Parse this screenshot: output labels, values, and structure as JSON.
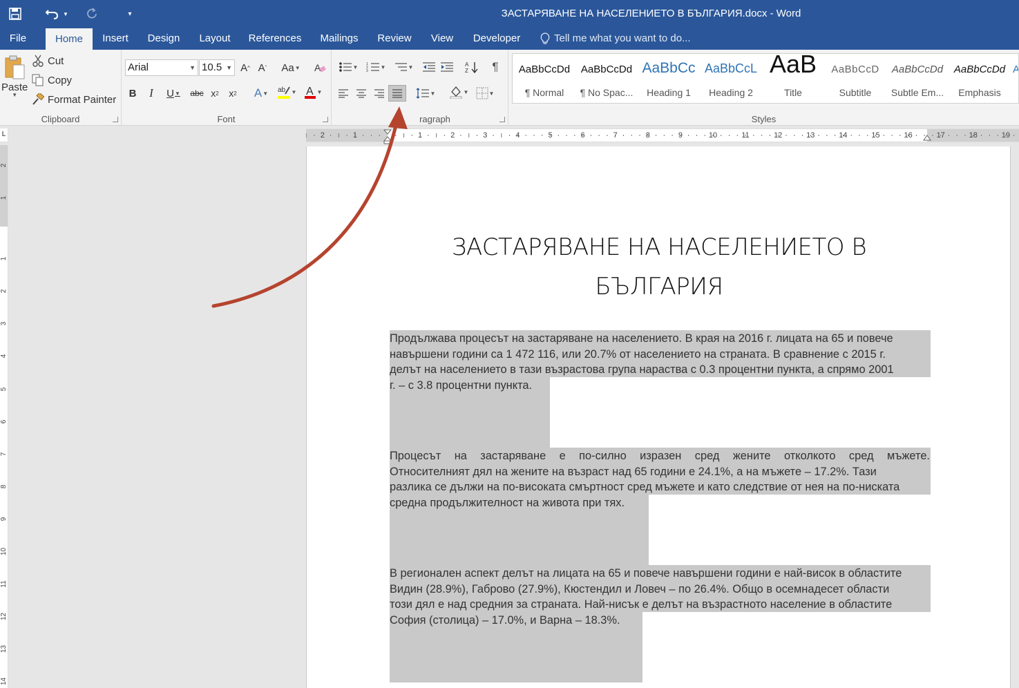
{
  "window": {
    "title": "ЗАСТАРЯВАНЕ НА НАСЕЛЕНИЕТО В БЪЛГАРИЯ.docx - Word"
  },
  "tabs": [
    "File",
    "Home",
    "Insert",
    "Design",
    "Layout",
    "References",
    "Mailings",
    "Review",
    "View",
    "Developer"
  ],
  "active_tab": "Home",
  "tell_me": "Tell me what you want to do...",
  "clipboard": {
    "paste": "Paste",
    "cut": "Cut",
    "copy": "Copy",
    "format_painter": "Format Painter",
    "label": "Clipboard"
  },
  "font": {
    "family": "Arial",
    "size": "10.5",
    "change_case": "Aa",
    "label": "Font"
  },
  "paragraph": {
    "label": "Paragraph",
    "label_visible": "ragraph",
    "active_alignment": "justify"
  },
  "styles": {
    "label": "Styles",
    "items": [
      {
        "preview": "AaBbCcDd",
        "name": "¶ Normal"
      },
      {
        "preview": "AaBbCcDd",
        "name": "¶ No Spac..."
      },
      {
        "preview": "AaBbCc",
        "name": "Heading 1"
      },
      {
        "preview": "AaBbCcL",
        "name": "Heading 2"
      },
      {
        "preview": "AaB",
        "name": "Title"
      },
      {
        "preview": "AaBbCcD",
        "name": "Subtitle"
      },
      {
        "preview": "AaBbCcDd",
        "name": "Subtle Em..."
      },
      {
        "preview": "AaBbCcDd",
        "name": "Emphasis"
      }
    ]
  },
  "ruler": {
    "h_left": [
      "2",
      "1"
    ],
    "h_right": [
      "1",
      "2",
      "3",
      "4",
      "5",
      "6",
      "7",
      "8",
      "9",
      "10",
      "11",
      "12",
      "13",
      "14",
      "15",
      "16",
      "17",
      "18",
      "19"
    ],
    "v_top": [
      "2",
      "1"
    ],
    "v_main": [
      "1",
      "2",
      "3",
      "4",
      "5",
      "6",
      "7",
      "8",
      "9",
      "10",
      "11",
      "12",
      "13",
      "14"
    ],
    "tab_marker": "L"
  },
  "document": {
    "title_line1": "ЗАСТАРЯВАНЕ НА НАСЕЛЕНИЕТО В",
    "title_line2": "БЪЛГАРИЯ",
    "paragraphs": [
      {
        "lines": [
          "Продължава процесът на застаряване на населението. В края на 2016 г. лицата на 65 и повече",
          "навършени години са 1 472 116, или 20.7% от населението на страната. В сравнение с 2015 г.",
          "делът на населението в тази възрастова група нараства с 0.3 процентни пункта, а спрямо 2001",
          "г. – с 3.8 процентни пункта."
        ]
      },
      {
        "lines": [
          "Процесът на застаряване е по-силно изразен сред жените отколкото сред мъжете.",
          "Относителният дял на жените на възраст над 65 години е 24.1%, а на мъжете – 17.2%. Тази",
          "разлика се дължи на по-високата смъртност сред мъжете и като следствие от нея на по-ниската",
          "средна продължителност на живота при тях."
        ]
      },
      {
        "lines": [
          "В регионален аспект делът на лицата на 65 и повече навършени години е най-висок в областите",
          "Видин (28.9%), Габрово (27.9%), Кюстендил и Ловеч – по 26.4%. Общо в осемнадесет области",
          "този дял е над средния за страната. Най-нисък е делът на възрастното население в областите",
          "София (столица) – 17.0%, и Варна – 18.3%."
        ]
      }
    ]
  },
  "colors": {
    "brand": "#2b579a",
    "highlight": "#c9c9c9",
    "arrow": "#b5442f"
  }
}
